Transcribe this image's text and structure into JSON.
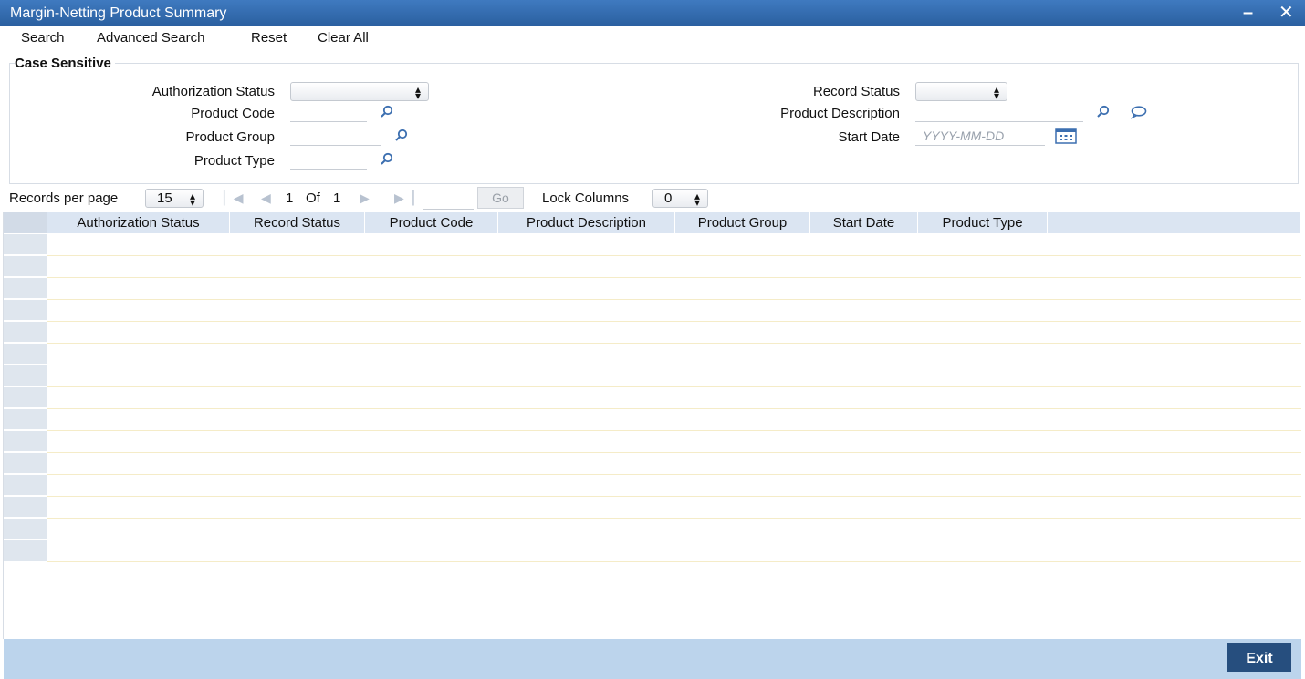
{
  "window": {
    "title": "Margin-Netting Product Summary",
    "minimize_glyph": "–",
    "close_glyph": "✕"
  },
  "menu": {
    "search": "Search",
    "advanced_search": "Advanced Search",
    "reset": "Reset",
    "clear_all": "Clear All"
  },
  "criteria": {
    "legend": "Case Sensitive",
    "authorization_status_label": "Authorization Status",
    "authorization_status_value": "",
    "product_code_label": "Product Code",
    "product_code_value": "",
    "product_group_label": "Product Group",
    "product_group_value": "",
    "product_type_label": "Product Type",
    "product_type_value": "",
    "record_status_label": "Record Status",
    "record_status_value": "",
    "product_description_label": "Product Description",
    "product_description_value": "",
    "start_date_label": "Start Date",
    "start_date_placeholder": "YYYY-MM-DD"
  },
  "pager": {
    "records_per_page_label": "Records per page",
    "records_per_page_value": "15",
    "current_page": "1",
    "of_label": "Of",
    "total_pages": "1",
    "go_label": "Go",
    "lock_columns_label": "Lock Columns",
    "lock_columns_value": "0"
  },
  "grid": {
    "columns": [
      "Authorization Status",
      "Record Status",
      "Product Code",
      "Product Description",
      "Product Group",
      "Start Date",
      "Product Type"
    ],
    "row_count": 15
  },
  "footer": {
    "exit_label": "Exit"
  },
  "icons": {
    "search": "search-icon",
    "comment": "comment-icon",
    "calendar": "calendar-icon",
    "first_page": "first-page-icon",
    "prev_page": "prev-page-icon",
    "next_page": "next-page-icon",
    "last_page": "last-page-icon"
  },
  "colors": {
    "titlebar": "#2f68ab",
    "header_bg": "#dbe5f2",
    "footer_bg": "#bcd4ec",
    "exit_button": "#264e7e",
    "icon": "#3c6fb0"
  }
}
